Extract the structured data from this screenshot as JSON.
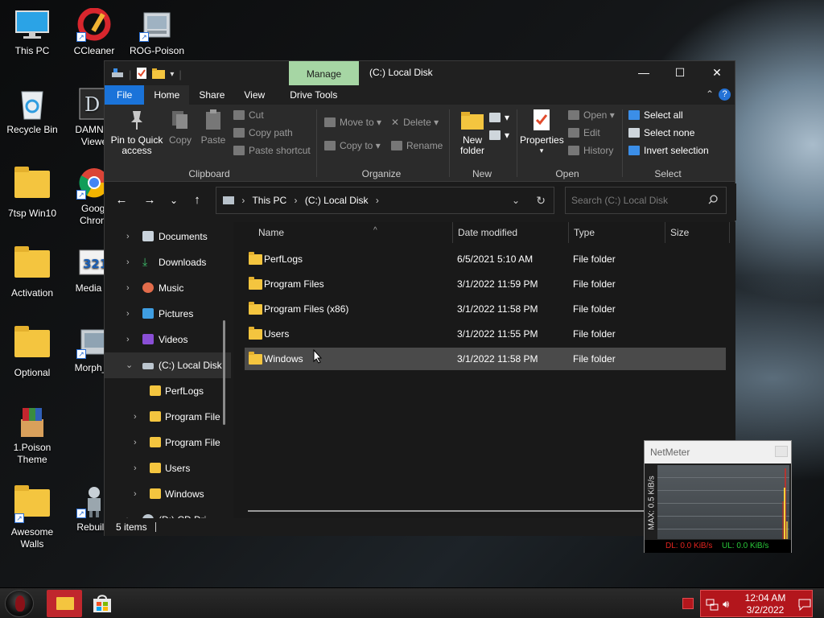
{
  "desktop": {
    "icons": [
      {
        "label": "This PC"
      },
      {
        "label": "CCleaner"
      },
      {
        "label": "ROG-Poison"
      },
      {
        "label": "Recycle Bin"
      },
      {
        "label": "DAMN N\nViewe"
      },
      {
        "label": "7tsp Win10"
      },
      {
        "label": "Googl\nChrom"
      },
      {
        "label": "Activation"
      },
      {
        "label": "Media Pl"
      },
      {
        "label": "Optional"
      },
      {
        "label": "Morph_P"
      },
      {
        "label": "1.Poison\nTheme"
      },
      {
        "label": "Awesome\nWalls"
      },
      {
        "label": "Rebuildi"
      }
    ]
  },
  "window": {
    "title": "(C:) Local Disk",
    "manage_tab": "Manage",
    "tabs": [
      "File",
      "Home",
      "Share",
      "View",
      "Drive Tools"
    ],
    "ribbon": {
      "clipboard": {
        "label": "Clipboard",
        "pin": "Pin to Quick\naccess",
        "copy": "Copy",
        "paste": "Paste",
        "cut": "Cut",
        "copy_path": "Copy path",
        "paste_shortcut": "Paste shortcut"
      },
      "organize": {
        "label": "Organize",
        "move_to": "Move to",
        "copy_to": "Copy to",
        "delete": "Delete",
        "rename": "Rename"
      },
      "new": {
        "label": "New",
        "new_folder": "New\nfolder"
      },
      "open": {
        "label": "Open",
        "properties": "Properties",
        "open": "Open",
        "edit": "Edit",
        "history": "History"
      },
      "select": {
        "label": "Select",
        "select_all": "Select all",
        "select_none": "Select none",
        "invert": "Invert selection"
      }
    },
    "address": {
      "crumbs": [
        "This PC",
        "(C:) Local Disk"
      ]
    },
    "search": {
      "placeholder": "Search (C:) Local Disk"
    },
    "nav_pane": [
      {
        "label": "Documents",
        "icon": "documents-icon",
        "color": "#c9d3dc"
      },
      {
        "label": "Downloads",
        "icon": "download-icon",
        "color": "#3fbf6b"
      },
      {
        "label": "Music",
        "icon": "music-icon",
        "color": "#e26c4b"
      },
      {
        "label": "Pictures",
        "icon": "pictures-icon",
        "color": "#3f9ee2"
      },
      {
        "label": "Videos",
        "icon": "videos-icon",
        "color": "#8a4fd6"
      },
      {
        "label": "(C:) Local Disk",
        "icon": "drive-icon",
        "color": "#bcc6cf"
      },
      {
        "label": "PerfLogs",
        "icon": "folder-icon",
        "color": "#f4c53f"
      },
      {
        "label": "Program File",
        "icon": "folder-icon",
        "color": "#f4c53f"
      },
      {
        "label": "Program File",
        "icon": "folder-icon",
        "color": "#f4c53f"
      },
      {
        "label": "Users",
        "icon": "folder-icon",
        "color": "#f4c53f"
      },
      {
        "label": "Windows",
        "icon": "folder-icon",
        "color": "#f4c53f"
      },
      {
        "label": "(D:) CD Dri",
        "icon": "cd-drive-icon",
        "color": "#bcc6cf"
      }
    ],
    "columns": [
      "Name",
      "Date modified",
      "Type",
      "Size"
    ],
    "files": [
      {
        "name": "PerfLogs",
        "date": "6/5/2021 5:10 AM",
        "type": "File folder"
      },
      {
        "name": "Program Files",
        "date": "3/1/2022 11:59 PM",
        "type": "File folder"
      },
      {
        "name": "Program Files (x86)",
        "date": "3/1/2022 11:58 PM",
        "type": "File folder"
      },
      {
        "name": "Users",
        "date": "3/1/2022 11:55 PM",
        "type": "File folder"
      },
      {
        "name": "Windows",
        "date": "3/1/2022 11:58 PM",
        "type": "File folder"
      }
    ],
    "status": "5 items"
  },
  "netmeter": {
    "title": "NetMeter",
    "axis": "MAX: 0.5 KiB/s",
    "dl": "DL: 0.0 KiB/s",
    "ul": "UL: 0.0 KiB/s"
  },
  "taskbar": {
    "time": "12:04 AM",
    "date": "3/2/2022"
  },
  "colors": {
    "accent": "#1a73d9",
    "manage": "#a6d6a4",
    "folder": "#f4c53f",
    "tray": "#b3161c"
  }
}
